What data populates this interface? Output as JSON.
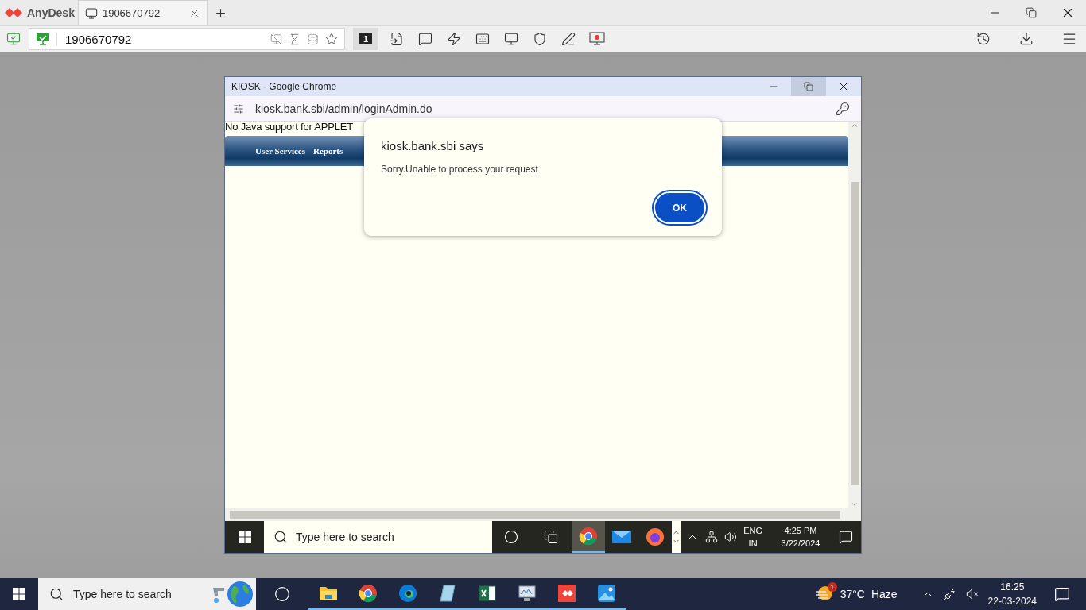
{
  "anydesk": {
    "app_name": "AnyDesk",
    "tabs": [
      {
        "label": "1906670792",
        "selected": true
      }
    ],
    "address": "1906670792",
    "session_badge": "1"
  },
  "remote": {
    "browser": {
      "title": "KIOSK - Google Chrome",
      "url": "kiosk.bank.sbi/admin/loginAdmin.do"
    },
    "page": {
      "notice": "No Java support for APPLET",
      "menu": [
        "User Services",
        "Reports"
      ]
    },
    "dialog": {
      "title": "kiosk.bank.sbi says",
      "message": "Sorry.Unable to process your request",
      "button": "OK"
    },
    "taskbar": {
      "search_placeholder": "Type here to search",
      "apps": [
        {
          "kind": "chrome",
          "selected": true
        },
        {
          "kind": "mail",
          "selected": false
        },
        {
          "kind": "firefox",
          "selected": false
        }
      ],
      "language": "ENG",
      "region": "IN",
      "time": "4:25 PM",
      "date": "3/22/2024"
    }
  },
  "taskbar": {
    "search_placeholder": "Type here to search",
    "apps": [
      {
        "kind": "files"
      },
      {
        "kind": "chrome"
      },
      {
        "kind": "edge"
      },
      {
        "kind": "notepad"
      },
      {
        "kind": "excel"
      },
      {
        "kind": "monitor"
      },
      {
        "kind": "anydesk"
      },
      {
        "kind": "photos"
      }
    ],
    "weather": {
      "badge": "1",
      "temperature": "37°C",
      "condition": "Haze"
    },
    "time": "16:25",
    "date": "22-03-2024"
  }
}
